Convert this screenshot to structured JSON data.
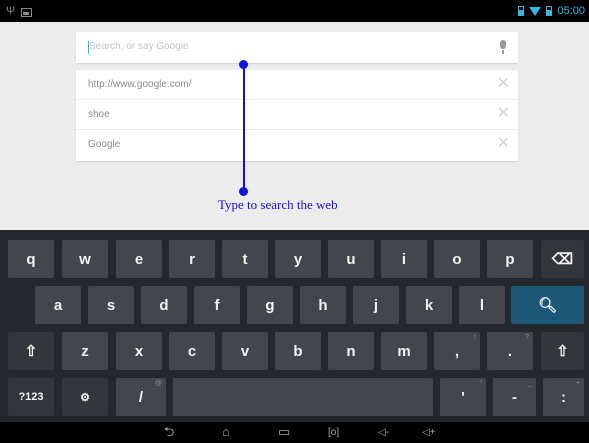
{
  "status_bar": {
    "left_icons": [
      "usb-icon",
      "image-icon"
    ],
    "right_icons": [
      "battery-small-icon",
      "wifi-icon",
      "battery-icon"
    ],
    "time": "05:00",
    "accent_color": "#33b5e5"
  },
  "search": {
    "placeholder": "Search, or say Google",
    "mic_icon": "mic-icon"
  },
  "suggestions": [
    {
      "text": "http://www.google.com/"
    },
    {
      "text": "shoe"
    },
    {
      "text": "Google"
    }
  ],
  "annotation": {
    "text": "Type to search the web",
    "color": "#1111dd"
  },
  "keyboard": {
    "row1": [
      "q",
      "w",
      "e",
      "r",
      "t",
      "y",
      "u",
      "i",
      "o",
      "p"
    ],
    "row2": [
      "a",
      "s",
      "d",
      "f",
      "g",
      "h",
      "j",
      "k",
      "l"
    ],
    "row3": [
      "z",
      "x",
      "c",
      "v",
      "b",
      "n",
      "m",
      ",",
      "."
    ],
    "row3_hints": {
      "comma": "!",
      "period": "?"
    },
    "row4": {
      "symbols": "?123",
      "settings": "⚙",
      "slash": "/",
      "slash_hint": "@",
      "apostrophe": "'",
      "apostrophe_hint": "\"",
      "dash": "-",
      "dash_hint": "_",
      "colon": ":",
      "colon_hint": "+"
    },
    "icons": {
      "backspace": "backspace-icon",
      "search": "search-icon",
      "shift": "shift-icon"
    },
    "colors": {
      "background": "#24272b",
      "key": "#43474d",
      "enter": "#1e5878"
    }
  },
  "nav_bar": {
    "back": "⮌",
    "home": "⌂",
    "recents": "▭",
    "screenshot": "[o]",
    "vol_down": "◁-",
    "vol_up": "◁+"
  }
}
